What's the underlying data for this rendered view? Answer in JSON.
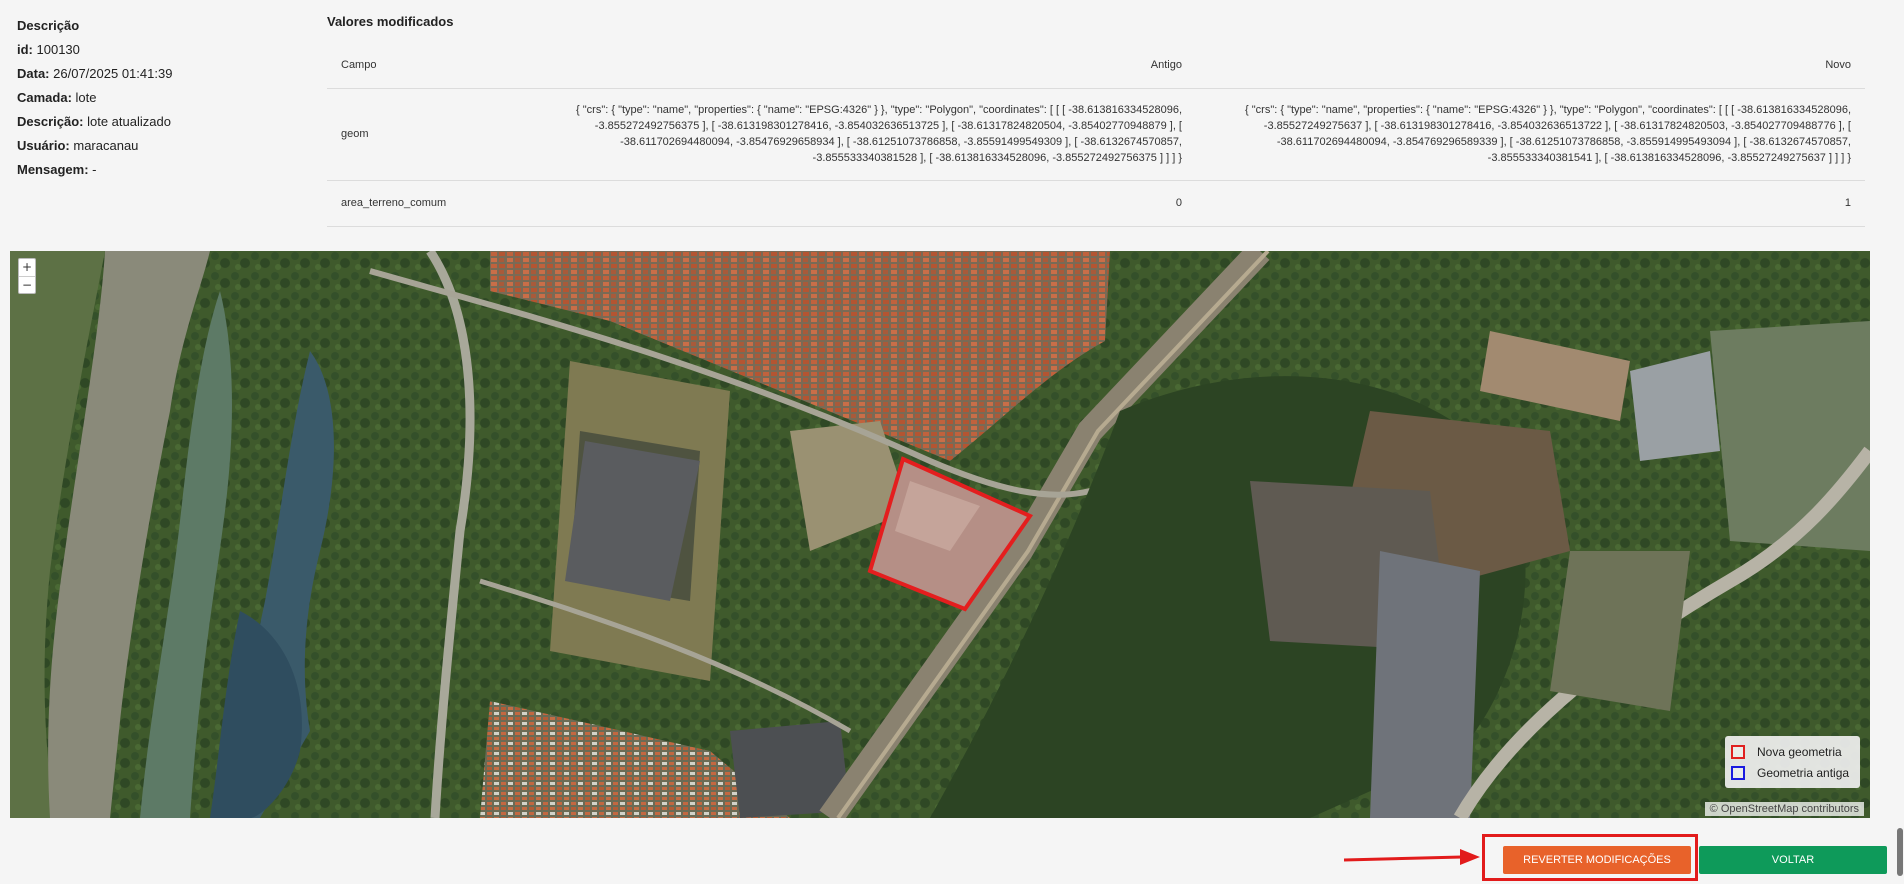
{
  "description": {
    "title": "Descrição",
    "fields": [
      {
        "label": "id:",
        "value": "100130"
      },
      {
        "label": "Data:",
        "value": "26/07/2025 01:41:39"
      },
      {
        "label": "Camada:",
        "value": "lote"
      },
      {
        "label": "Descrição:",
        "value": "lote atualizado"
      },
      {
        "label": "Usuário:",
        "value": "maracanau"
      },
      {
        "label": "Mensagem:",
        "value": "-"
      }
    ]
  },
  "changes": {
    "title": "Valores modificados",
    "headers": {
      "field": "Campo",
      "old": "Antigo",
      "new": "Novo"
    },
    "rows": [
      {
        "field": "geom",
        "old": "{ \"crs\": { \"type\": \"name\", \"properties\": { \"name\": \"EPSG:4326\" } }, \"type\": \"Polygon\", \"coordinates\": [ [ [ -38.613816334528096, -3.855272492756375 ], [ -38.613198301278416, -3.854032636513725 ], [ -38.61317824820504, -3.85402770948879 ], [ -38.611702694480094, -3.85476929658934 ], [ -38.61251073786858, -3.85591499549309 ], [ -38.6132674570857, -3.855533340381528 ], [ -38.613816334528096, -3.855272492756375 ] ] ] }",
        "new": "{ \"crs\": { \"type\": \"name\", \"properties\": { \"name\": \"EPSG:4326\" } }, \"type\": \"Polygon\", \"coordinates\": [ [ [ -38.613816334528096, -3.85527249275637 ], [ -38.613198301278416, -3.854032636513722 ], [ -38.61317824820503, -3.854027709488776 ], [ -38.611702694480094, -3.854769296589339 ], [ -38.61251073786858, -3.855914995493094 ], [ -38.6132674570857, -3.855533340381541 ], [ -38.613816334528096, -3.85527249275637 ] ] ] }"
      },
      {
        "field": "area_terreno_comum",
        "old": "0",
        "new": "1"
      }
    ]
  },
  "map": {
    "zoom_in": "+",
    "zoom_out": "−",
    "legend": [
      {
        "label": "Nova geometria",
        "color": "#e02020"
      },
      {
        "label": "Geometria antiga",
        "color": "#1a1ae0"
      }
    ],
    "attribution": "© OpenStreetMap contributors"
  },
  "buttons": {
    "revert": "REVERTER MODIFICAÇÕES",
    "back": "VOLTAR"
  }
}
